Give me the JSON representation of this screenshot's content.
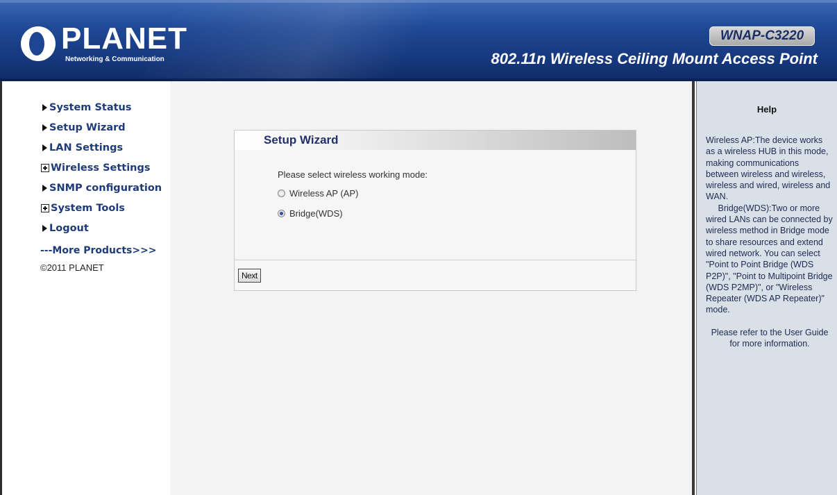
{
  "header": {
    "brand_name": "PLANET",
    "brand_sub": "Networking & Communication",
    "model": "WNAP-C3220",
    "product_title": "802.11n Wireless Ceiling Mount Access Point",
    "colors": {
      "header_blue": "#1f4895",
      "badge_text": "#1a2f66"
    }
  },
  "sidebar": {
    "items": [
      {
        "label": "System Status",
        "icon": "arrow-right-icon"
      },
      {
        "label": "Setup Wizard",
        "icon": "arrow-right-icon"
      },
      {
        "label": "LAN Settings",
        "icon": "arrow-right-icon"
      },
      {
        "label": "Wireless Settings",
        "icon": "expand-plus-icon"
      },
      {
        "label": "SNMP configuration",
        "icon": "arrow-right-icon"
      },
      {
        "label": "System Tools",
        "icon": "expand-plus-icon"
      },
      {
        "label": "Logout",
        "icon": "arrow-right-icon"
      }
    ],
    "more_products": "---More Products>>>",
    "copyright": "©2011 PLANET"
  },
  "wizard": {
    "title": "Setup Wizard",
    "prompt": "Please select wireless working mode:",
    "options": [
      {
        "label": "Wireless AP (AP)",
        "checked": false
      },
      {
        "label": "Bridge(WDS)",
        "checked": true
      }
    ],
    "next_label": "Next"
  },
  "help": {
    "title": "Help",
    "p1": "Wireless AP:The device works as a wireless HUB in this mode, making communications between wireless and wireless, wireless and wired, wireless and WAN.",
    "p2": "Bridge(WDS):Two or more wired LANs can be connected by wireless method in Bridge mode to share resources and extend wired network. You can select \"Point to Point Bridge (WDS P2P)\", \"Point to Multipoint Bridge (WDS P2MP)\", or \"Wireless Repeater (WDS AP Repeater)\" mode.",
    "p3": "Please refer to the User Guide for more information."
  }
}
